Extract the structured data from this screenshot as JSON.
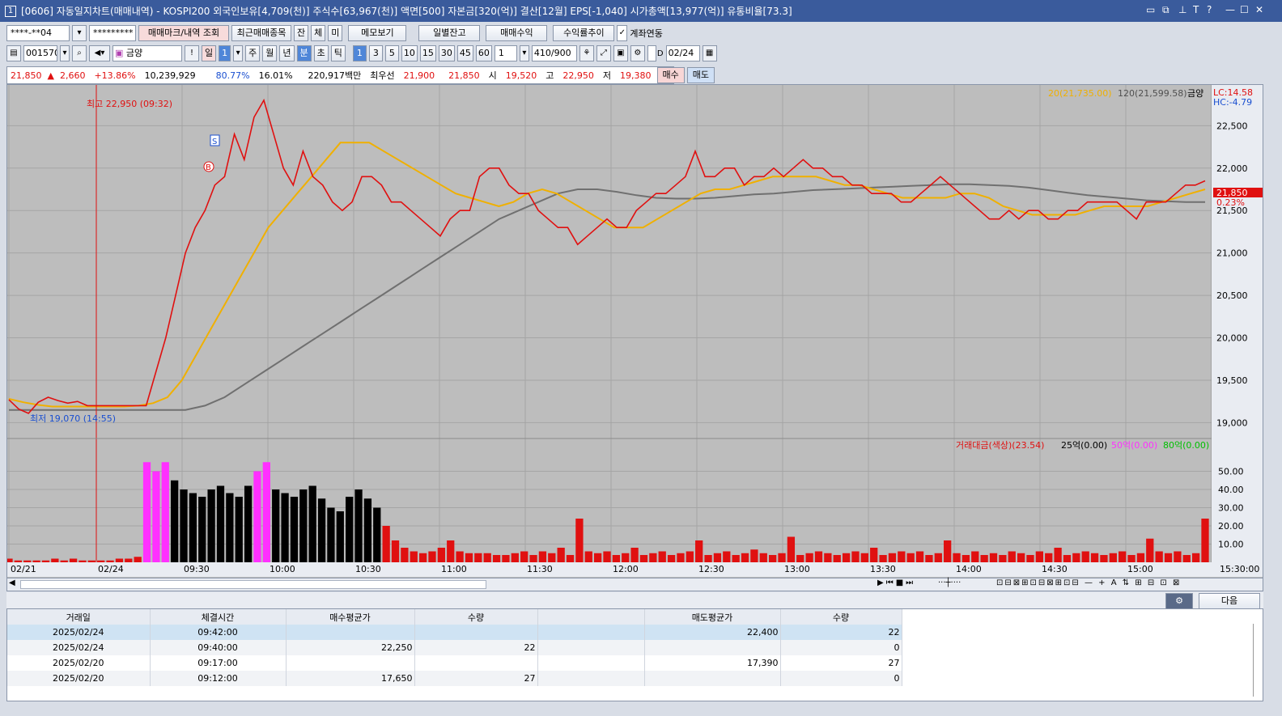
{
  "title": {
    "no": "1",
    "text": "[0606] 자동일지차트(매매내역) - KOSPI200 외국인보유[4,709(천)] 주식수[63,967(천)] 액면[500] 자본금[320(억)] 결산[12월] EPS[-1,040] 시가총액[13,977(억)] 유통비율[73.3]"
  },
  "toolbar1": {
    "account": "****-**04",
    "password": "*********",
    "buttons": [
      "매매마크/내역 조회",
      "최근매매종목",
      "잔",
      "체",
      "미",
      "메모보기",
      "일별잔고",
      "매매수익",
      "수익률추이"
    ],
    "link_label": "계좌연동"
  },
  "toolbar2": {
    "code": "001570",
    "name": "금양",
    "periods": [
      "일",
      "1",
      "주",
      "월",
      "년",
      "분",
      "초",
      "틱"
    ],
    "intervals": [
      "1",
      "3",
      "5",
      "10",
      "15",
      "30",
      "45",
      "60"
    ],
    "count": "1",
    "range": "410",
    "range_total": "/900",
    "date": "02/24"
  },
  "info": {
    "price": "21,850",
    "arrow": "▲",
    "change": "2,660",
    "rate": "+13.86%",
    "volume": "10,239,929",
    "ratio1": "80.77%",
    "ratio2": "16.01%",
    "amount": "220,917백만",
    "quote_label": "최우선",
    "ask": "21,900",
    "bid": "21,850",
    "open_label": "시",
    "open": "19,520",
    "high_label": "고",
    "high": "22,950",
    "low_label": "저",
    "low": "19,380",
    "buy": "매수",
    "sell": "매도"
  },
  "chart": {
    "legend_ma": "20(21,735.00)",
    "legend_ma2": "120(21,599.58)",
    "legend_name": "금양",
    "lc": "LC:14.58",
    "hc": "HC:-4.79",
    "high_label": "최고 22,950 (09:32)",
    "low_label": "최저 19,070 (14:55)",
    "cur": "21,850",
    "cur_pct": "0.23%",
    "mark_s": "S",
    "mark_b": "B",
    "vol_legend": "거래대금(색상)(23.54)",
    "vol_l2": "25억(0.00)",
    "vol_l3": "50억(0.00)",
    "vol_l4": "80억(0.00)",
    "end_time": "15:30:00"
  },
  "colors": {
    "up": "#e01010",
    "down": "#1a4fd0",
    "ma20": "#f0b000",
    "ma120": "#707070",
    "bg": "#bdbdbd",
    "vol_mid": "#000000",
    "vol_hi": "#ff30ff"
  },
  "chart_data": {
    "type": "line",
    "x_labels": [
      "02/21",
      "02/24",
      "09:30",
      "10:00",
      "10:30",
      "11:00",
      "11:30",
      "12:00",
      "12:30",
      "13:00",
      "13:30",
      "14:00",
      "14:30",
      "15:00"
    ],
    "y_ticks": [
      22500,
      22000,
      21500,
      21000,
      20500,
      20000,
      19500,
      19000
    ],
    "ylim": [
      18880,
      22980
    ],
    "vol_ticks": [
      "50.00",
      "40.00",
      "30.00",
      "20.00",
      "10.00"
    ],
    "vol_lim": [
      0,
      60
    ],
    "close": [
      19270,
      19160,
      19110,
      19240,
      19300,
      19260,
      19230,
      19250,
      19200,
      19200,
      19200,
      19200,
      19200,
      19200,
      19200,
      19600,
      20000,
      20500,
      21000,
      21300,
      21500,
      21800,
      21900,
      22400,
      22100,
      22600,
      22800,
      22400,
      22000,
      21800,
      22200,
      21900,
      21800,
      21600,
      21500,
      21600,
      21900,
      21900,
      21800,
      21600,
      21600,
      21500,
      21400,
      21300,
      21200,
      21400,
      21500,
      21500,
      21900,
      22000,
      22000,
      21800,
      21700,
      21700,
      21500,
      21400,
      21300,
      21300,
      21100,
      21200,
      21300,
      21400,
      21300,
      21300,
      21500,
      21600,
      21700,
      21700,
      21800,
      21900,
      22200,
      21900,
      21900,
      22000,
      22000,
      21800,
      21900,
      21900,
      22000,
      21900,
      22000,
      22100,
      22000,
      22000,
      21900,
      21900,
      21800,
      21800,
      21700,
      21700,
      21700,
      21600,
      21600,
      21700,
      21800,
      21900,
      21800,
      21700,
      21600,
      21500,
      21400,
      21400,
      21500,
      21400,
      21500,
      21500,
      21400,
      21400,
      21500,
      21500,
      21600,
      21600,
      21600,
      21600,
      21500,
      21400,
      21600,
      21600,
      21600,
      21700,
      21800,
      21800,
      21850
    ],
    "ma20": [
      19280,
      19240,
      19210,
      19190,
      19190,
      19190,
      19190,
      19190,
      19190,
      19200,
      19230,
      19300,
      19500,
      19800,
      20100,
      20400,
      20700,
      21000,
      21300,
      21500,
      21700,
      21900,
      22100,
      22300,
      22300,
      22300,
      22200,
      22100,
      22000,
      21900,
      21800,
      21700,
      21650,
      21600,
      21550,
      21600,
      21700,
      21750,
      21700,
      21600,
      21500,
      21400,
      21300,
      21300,
      21300,
      21400,
      21500,
      21600,
      21700,
      21750,
      21750,
      21800,
      21850,
      21900,
      21900,
      21900,
      21900,
      21850,
      21800,
      21800,
      21750,
      21700,
      21650,
      21650,
      21650,
      21650,
      21700,
      21700,
      21650,
      21550,
      21500,
      21450,
      21450,
      21450,
      21450,
      21500,
      21550,
      21550,
      21550,
      21550,
      21600,
      21650,
      21700,
      21750
    ],
    "ma120": [
      19150,
      19150,
      19150,
      19150,
      19150,
      19150,
      19150,
      19150,
      19150,
      19150,
      19200,
      19300,
      19450,
      19600,
      19750,
      19900,
      20050,
      20200,
      20350,
      20500,
      20650,
      20800,
      20950,
      21100,
      21250,
      21400,
      21500,
      21600,
      21700,
      21750,
      21750,
      21720,
      21680,
      21650,
      21640,
      21640,
      21650,
      21670,
      21690,
      21700,
      21720,
      21740,
      21750,
      21760,
      21770,
      21780,
      21790,
      21800,
      21810,
      21810,
      21800,
      21790,
      21770,
      21740,
      21710,
      21680,
      21660,
      21640,
      21620,
      21610,
      21600,
      21600
    ],
    "volume": [
      2,
      1,
      1,
      1,
      1,
      2,
      1,
      2,
      1,
      1,
      1,
      1,
      2,
      2,
      3,
      55,
      50,
      55,
      45,
      40,
      38,
      36,
      40,
      42,
      38,
      36,
      42,
      50,
      55,
      40,
      38,
      36,
      40,
      42,
      35,
      30,
      28,
      36,
      40,
      35,
      30,
      20,
      12,
      8,
      6,
      5,
      6,
      8,
      12,
      6,
      5,
      5,
      5,
      4,
      4,
      5,
      6,
      4,
      6,
      5,
      8,
      4,
      24,
      6,
      5,
      6,
      4,
      5,
      8,
      4,
      5,
      6,
      4,
      5,
      6,
      12,
      4,
      5,
      6,
      4,
      5,
      7,
      5,
      4,
      5,
      14,
      4,
      5,
      6,
      5,
      4,
      5,
      6,
      5,
      8,
      4,
      5,
      6,
      5,
      6,
      4,
      5,
      12,
      5,
      4,
      6,
      4,
      5,
      4,
      6,
      5,
      4,
      6,
      5,
      8,
      4,
      5,
      6,
      5,
      4,
      5,
      6,
      4,
      5,
      13,
      6,
      5,
      6,
      4,
      5,
      24
    ]
  },
  "bottom": {
    "next": "다음",
    "headers": [
      "거래일",
      "체결시간",
      "매수평균가",
      "수량",
      "",
      "매도평균가",
      "수량"
    ],
    "rows": [
      [
        "2025/02/24",
        "09:42:00",
        "",
        "",
        "",
        "22,400",
        "22"
      ],
      [
        "2025/02/24",
        "09:40:00",
        "22,250",
        "22",
        "",
        "",
        "0"
      ],
      [
        "2025/02/20",
        "09:17:00",
        "",
        "",
        "",
        "17,390",
        "27"
      ],
      [
        "2025/02/20",
        "09:12:00",
        "17,650",
        "27",
        "",
        "",
        "0"
      ]
    ]
  }
}
